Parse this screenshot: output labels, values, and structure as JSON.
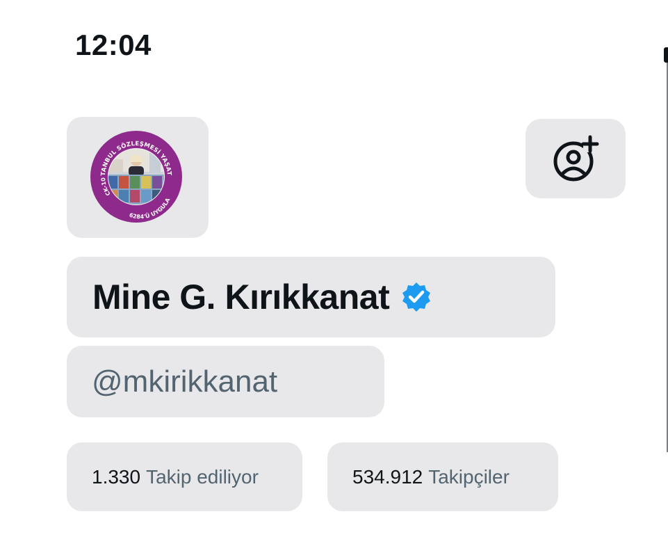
{
  "status_bar": {
    "time": "12:04"
  },
  "profile": {
    "avatar": {
      "arc_top_text": "İSTANBUL SÖZLEŞMESİ YAŞATIR",
      "arc_left_text": "TCK-103",
      "arc_bottom_text": "6284'Ü UYGULA",
      "ring_color": "#8e2a8b"
    },
    "display_name": "Mine G. Kırıkkanat",
    "verified": true,
    "verified_color": "#1d9bf0",
    "handle": "@mkirikkanat",
    "following": {
      "count": "1.330",
      "label": "Takip ediliyor"
    },
    "followers": {
      "count": "534.912",
      "label": "Takipçiler"
    }
  },
  "actions": {
    "follow_icon": "add-user-icon"
  }
}
